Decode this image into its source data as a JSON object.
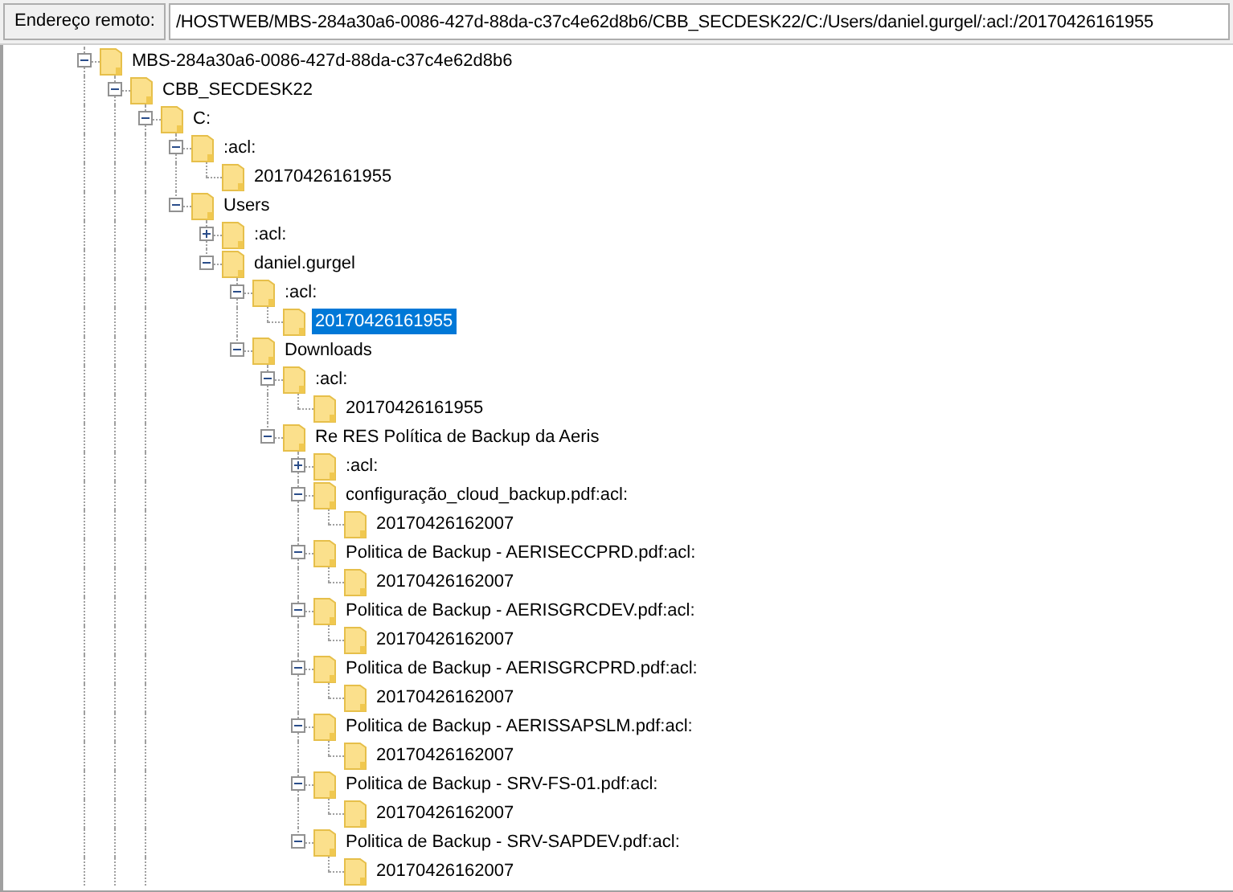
{
  "address_bar": {
    "label": "Endereço remoto:",
    "value": "/HOSTWEB/MBS-284a30a6-0086-427d-88da-c37c4e62d8b6/CBB_SECDESK22/C:/Users/daniel.gurgel/:acl:/20170426161955"
  },
  "tree": [
    {
      "label": "MBS-284a30a6-0086-427d-88da-c37c4e62d8b6",
      "expanded": true,
      "continues": true,
      "selected": false,
      "children": [
        {
          "label": "CBB_SECDESK22",
          "expanded": true,
          "continues": true,
          "selected": false,
          "children": [
            {
              "label": "C:",
              "expanded": true,
              "continues": true,
              "selected": false,
              "children": [
                {
                  "label": ":acl:",
                  "expanded": true,
                  "selected": false,
                  "children": [
                    {
                      "label": "20170426161955",
                      "selected": false
                    }
                  ]
                },
                {
                  "label": "Users",
                  "expanded": true,
                  "selected": false,
                  "children": [
                    {
                      "label": ":acl:",
                      "expanded": false,
                      "selected": false
                    },
                    {
                      "label": "daniel.gurgel",
                      "expanded": true,
                      "selected": false,
                      "children": [
                        {
                          "label": ":acl:",
                          "expanded": true,
                          "selected": false,
                          "children": [
                            {
                              "label": "20170426161955",
                              "selected": true
                            }
                          ]
                        },
                        {
                          "label": "Downloads",
                          "expanded": true,
                          "selected": false,
                          "children": [
                            {
                              "label": ":acl:",
                              "expanded": true,
                              "selected": false,
                              "children": [
                                {
                                  "label": "20170426161955",
                                  "selected": false
                                }
                              ]
                            },
                            {
                              "label": "Re RES Política de Backup da Aeris",
                              "expanded": true,
                              "selected": false,
                              "children": [
                                {
                                  "label": ":acl:",
                                  "expanded": false,
                                  "selected": false
                                },
                                {
                                  "label": "configuração_cloud_backup.pdf:acl:",
                                  "expanded": true,
                                  "selected": false,
                                  "children": [
                                    {
                                      "label": "20170426162007",
                                      "selected": false
                                    }
                                  ]
                                },
                                {
                                  "label": "Politica de Backup - AERISECCPRD.pdf:acl:",
                                  "expanded": true,
                                  "selected": false,
                                  "children": [
                                    {
                                      "label": "20170426162007",
                                      "selected": false
                                    }
                                  ]
                                },
                                {
                                  "label": "Politica de Backup - AERISGRCDEV.pdf:acl:",
                                  "expanded": true,
                                  "selected": false,
                                  "children": [
                                    {
                                      "label": "20170426162007",
                                      "selected": false
                                    }
                                  ]
                                },
                                {
                                  "label": "Politica de Backup - AERISGRCPRD.pdf:acl:",
                                  "expanded": true,
                                  "selected": false,
                                  "children": [
                                    {
                                      "label": "20170426162007",
                                      "selected": false
                                    }
                                  ]
                                },
                                {
                                  "label": "Politica de Backup - AERISSAPSLM.pdf:acl:",
                                  "expanded": true,
                                  "selected": false,
                                  "children": [
                                    {
                                      "label": "20170426162007",
                                      "selected": false
                                    }
                                  ]
                                },
                                {
                                  "label": "Politica de Backup - SRV-FS-01.pdf:acl:",
                                  "expanded": true,
                                  "selected": false,
                                  "children": [
                                    {
                                      "label": "20170426162007",
                                      "selected": false
                                    }
                                  ]
                                },
                                {
                                  "label": "Politica de Backup - SRV-SAPDEV.pdf:acl:",
                                  "expanded": true,
                                  "selected": false,
                                  "children": [
                                    {
                                      "label": "20170426162007",
                                      "selected": false
                                    }
                                  ]
                                }
                              ]
                            }
                          ]
                        }
                      ]
                    }
                  ]
                }
              ]
            }
          ]
        }
      ]
    }
  ]
}
